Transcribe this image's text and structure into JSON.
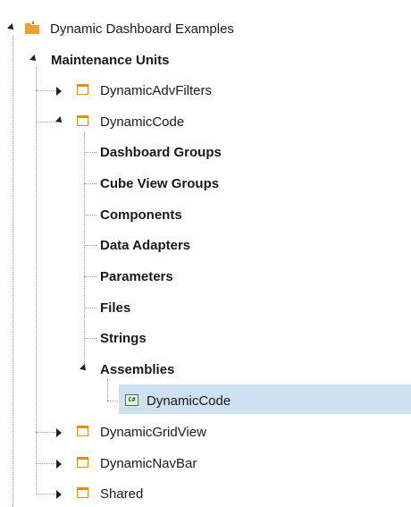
{
  "tree": {
    "root": {
      "label": "Dynamic Dashboard Examples",
      "icon": "folder-icon",
      "icon_color": "#f0a030"
    },
    "maintenance": {
      "label": "Maintenance Units"
    },
    "units": [
      {
        "label": "DynamicAdvFilters",
        "expanded": false
      },
      {
        "label": "DynamicCode",
        "expanded": true
      },
      {
        "label": "DynamicGridView",
        "expanded": false
      },
      {
        "label": "DynamicNavBar",
        "expanded": false
      },
      {
        "label": "Shared",
        "expanded": false
      }
    ],
    "dynamic_code_children": [
      {
        "label": "Dashboard Groups"
      },
      {
        "label": "Cube View Groups"
      },
      {
        "label": "Components"
      },
      {
        "label": "Data Adapters"
      },
      {
        "label": "Parameters"
      },
      {
        "label": "Files"
      },
      {
        "label": "Strings"
      },
      {
        "label": "Assemblies"
      }
    ],
    "assembly_item": {
      "label": "DynamicCode",
      "icon": "csharp-file-icon",
      "selected": true,
      "selected_color": "#cfe0f3"
    }
  }
}
